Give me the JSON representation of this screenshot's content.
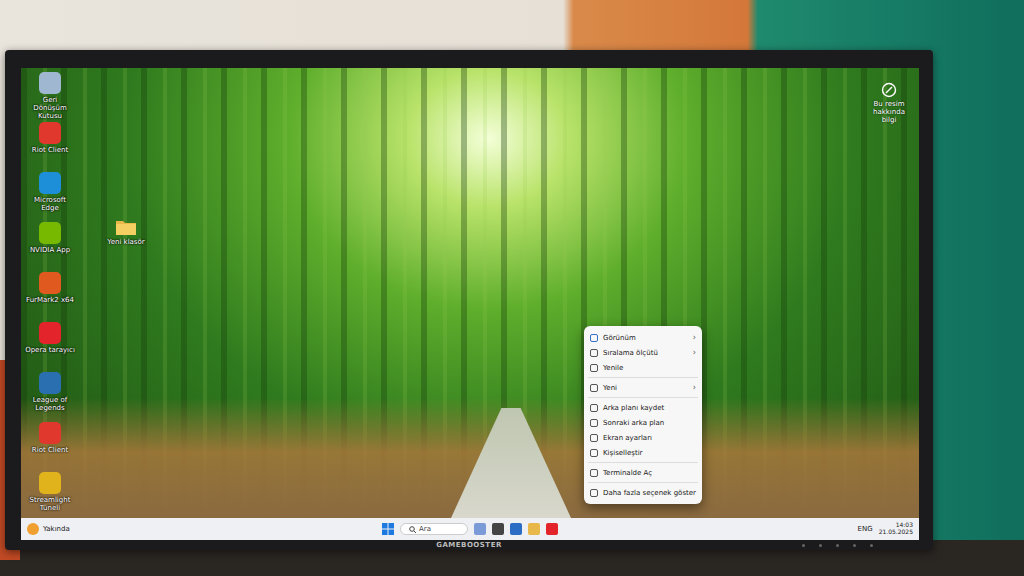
{
  "monitor": {
    "brand": "GAMEBOOSTER"
  },
  "desktop": {
    "icons": [
      {
        "label": "Geri Dönüşüm Kutusu",
        "color": "#9fb7d0"
      },
      {
        "label": "Riot Client",
        "color": "#e0382c"
      },
      {
        "label": "Microsoft Edge",
        "color": "#1d8fd8"
      },
      {
        "label": "NVIDIA App",
        "color": "#76b900"
      },
      {
        "label": "FurMark2 x64",
        "color": "#e05a20"
      },
      {
        "label": "Opera tarayıcı",
        "color": "#e3242b"
      },
      {
        "label": "League of Legends",
        "color": "#2a6fb0"
      },
      {
        "label": "Riot Client",
        "color": "#e0382c"
      },
      {
        "label": "Streamlight Tüneli",
        "color": "#e0b21c"
      }
    ],
    "folder": {
      "label": "Yeni klasör"
    },
    "spotlight": {
      "label": "Bu resim hakkında bilgi"
    }
  },
  "context_menu": {
    "submenu_glyph": "›",
    "items": [
      {
        "label": "Görünüm",
        "submenu": true,
        "separator_after": false
      },
      {
        "label": "Sıralama ölçütü",
        "submenu": true,
        "separator_after": false
      },
      {
        "label": "Yenile",
        "submenu": false,
        "separator_after": true
      },
      {
        "label": "Yeni",
        "submenu": true,
        "separator_after": true
      },
      {
        "label": "Arka planı kaydet",
        "submenu": false,
        "separator_after": false
      },
      {
        "label": "Sonraki arka plan",
        "submenu": false,
        "separator_after": false
      },
      {
        "label": "Ekran ayarları",
        "submenu": false,
        "separator_after": false
      },
      {
        "label": "Kişiselleştir",
        "submenu": false,
        "separator_after": true
      },
      {
        "label": "Terminalde Aç",
        "submenu": false,
        "separator_after": true
      },
      {
        "label": "Daha fazla seçenek göster",
        "submenu": false,
        "separator_after": false
      }
    ]
  },
  "taskbar": {
    "widget": "Yakında",
    "search": {
      "placeholder": "Ara"
    },
    "tray": "ENG",
    "time": "14:03",
    "date": "21.05.2025"
  }
}
